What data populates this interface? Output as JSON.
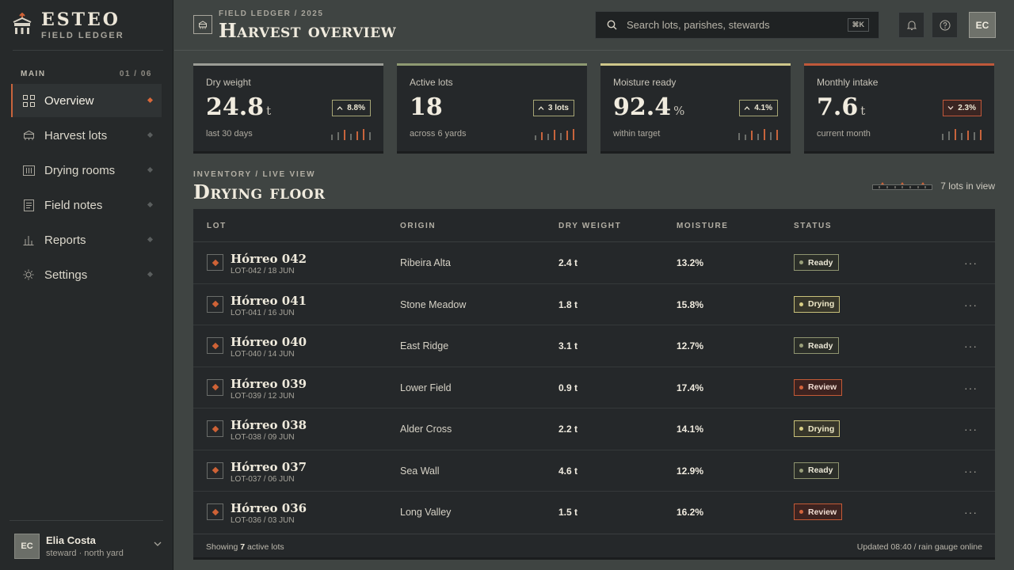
{
  "brand": {
    "name": "ESTEO",
    "subtitle": "FIELD LEDGER"
  },
  "nav": {
    "section_label": "MAIN",
    "section_count": "01 / 06",
    "items": [
      {
        "label": "Overview",
        "icon": "grid-icon",
        "active": true
      },
      {
        "label": "Harvest lots",
        "icon": "granary-icon",
        "active": false
      },
      {
        "label": "Drying rooms",
        "icon": "rack-icon",
        "active": false
      },
      {
        "label": "Field notes",
        "icon": "note-icon",
        "active": false
      },
      {
        "label": "Reports",
        "icon": "bar-chart-icon",
        "active": false
      },
      {
        "label": "Settings",
        "icon": "sun-gear-icon",
        "active": false
      }
    ]
  },
  "user": {
    "initials": "EC",
    "name": "Elia Costa",
    "role": "steward · north yard"
  },
  "header": {
    "breadcrumb": "FIELD LEDGER / 2025",
    "title": "Harvest overview",
    "search_placeholder": "Search lots, parishes, stewards",
    "search_shortcut": "⌘K",
    "avatar_initials": "EC"
  },
  "kpis": [
    {
      "label": "Dry weight",
      "value": "24.8",
      "unit": "t",
      "badge": "8.8%",
      "trend": "up",
      "note": "last 30 days",
      "accent": "#9c9d96"
    },
    {
      "label": "Active lots",
      "value": "18",
      "unit": "",
      "badge": "3 lots",
      "trend": "up",
      "note": "across 6 yards",
      "accent": "#8f9a72"
    },
    {
      "label": "Moisture ready",
      "value": "92.4",
      "unit": "%",
      "badge": "4.1%",
      "trend": "up",
      "note": "within target",
      "accent": "#cfc78a"
    },
    {
      "label": "Monthly intake",
      "value": "7.6",
      "unit": "t",
      "badge": "2.3%",
      "trend": "down",
      "note": "current month",
      "accent": "#c0583a"
    }
  ],
  "section": {
    "subtitle": "INVENTORY / LIVE VIEW",
    "title": "Drying floor",
    "in_view": "7 lots in view"
  },
  "table": {
    "columns": [
      "LOT",
      "ORIGIN",
      "DRY WEIGHT",
      "MOISTURE",
      "STATUS"
    ],
    "rows": [
      {
        "name": "Hórreo 042",
        "id": "LOT-042 / 18 JUN",
        "origin": "Ribeira Alta",
        "weight": "2.4 t",
        "moisture": "13.2%",
        "status": "Ready",
        "kind": "ready"
      },
      {
        "name": "Hórreo 041",
        "id": "LOT-041 / 16 JUN",
        "origin": "Stone Meadow",
        "weight": "1.8 t",
        "moisture": "15.8%",
        "status": "Drying",
        "kind": "drying"
      },
      {
        "name": "Hórreo 040",
        "id": "LOT-040 / 14 JUN",
        "origin": "East Ridge",
        "weight": "3.1 t",
        "moisture": "12.7%",
        "status": "Ready",
        "kind": "ready"
      },
      {
        "name": "Hórreo 039",
        "id": "LOT-039 / 12 JUN",
        "origin": "Lower Field",
        "weight": "0.9 t",
        "moisture": "17.4%",
        "status": "Review",
        "kind": "review"
      },
      {
        "name": "Hórreo 038",
        "id": "LOT-038 / 09 JUN",
        "origin": "Alder Cross",
        "weight": "2.2 t",
        "moisture": "14.1%",
        "status": "Drying",
        "kind": "drying"
      },
      {
        "name": "Hórreo 037",
        "id": "LOT-037 / 06 JUN",
        "origin": "Sea Wall",
        "weight": "4.6 t",
        "moisture": "12.9%",
        "status": "Ready",
        "kind": "ready"
      },
      {
        "name": "Hórreo 036",
        "id": "LOT-036 / 03 JUN",
        "origin": "Long Valley",
        "weight": "1.5 t",
        "moisture": "16.2%",
        "status": "Review",
        "kind": "review"
      }
    ],
    "footer_prefix": "Showing",
    "footer_count": "7",
    "footer_suffix": "active lots",
    "footer_right": "Updated 08:40 / rain gauge online"
  }
}
